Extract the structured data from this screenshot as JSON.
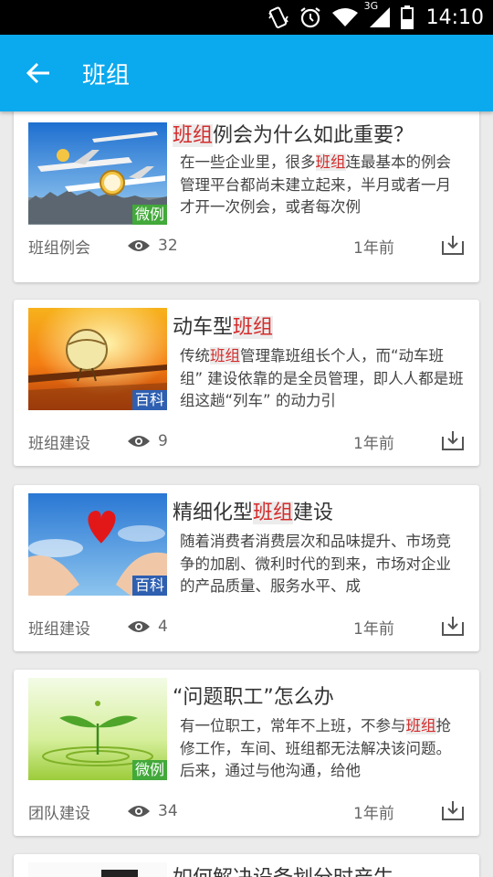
{
  "statusbar": {
    "time": "14:10",
    "network": "3G"
  },
  "appbar": {
    "title": "班组"
  },
  "articles": [
    {
      "title_hl": "班组",
      "title_rest": "例会为什么如此重要？",
      "desc_pre": "在一些企业里，很多",
      "desc_hl": "班组",
      "desc_post": "连最基本的例会管理平台都尚未建立起来，半月或者一月才开一次例会，或者每次例",
      "tag": "微例",
      "category": "班组例会",
      "views": "32",
      "time": "1年前"
    },
    {
      "title_pre": "动车型",
      "title_hl": "班组",
      "desc_pre": "传统",
      "desc_hl": "班组",
      "desc_post": "管理靠班组长个人，而“动车班组” 建设依靠的是全员管理，即人人都是班组这趟“列车” 的动力引",
      "tag": "百科",
      "category": "班组建设",
      "views": "9",
      "time": "1年前"
    },
    {
      "title_pre": "精细化型",
      "title_hl": "班组",
      "title_post": "建设",
      "desc": "随着消费者消费层次和品味提升、市场竞争的加剧、微利时代的到来，市场对企业的产品质量、服务水平、成",
      "tag": "百科",
      "category": "班组建设",
      "views": "4",
      "time": "1年前"
    },
    {
      "title": "“问题职工”怎么办",
      "desc_pre": "有一位职工，常年不上班，不参与",
      "desc_hl": "班组",
      "desc_post": "抢修工作，车间、班组都无法解决该问题。后来，通过与他沟通，给他",
      "tag": "微例",
      "category": "团队建设",
      "views": "34",
      "time": "1年前"
    },
    {
      "title": "如何解决设备划分时产生"
    }
  ]
}
